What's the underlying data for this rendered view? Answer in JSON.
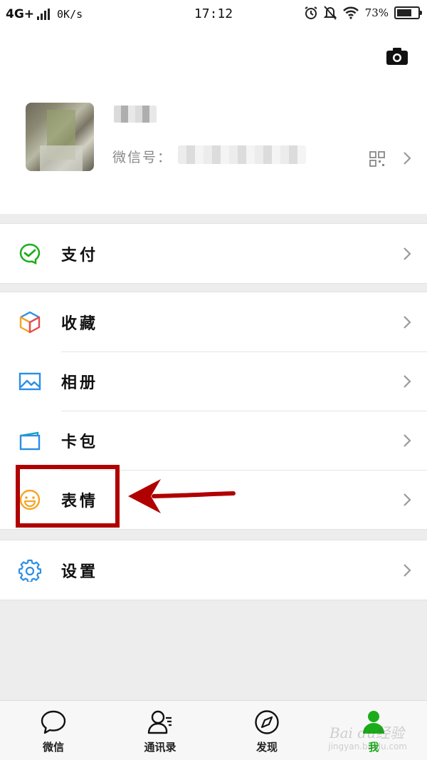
{
  "status_bar": {
    "network": "4G+",
    "speed": "0K/s",
    "time": "17:12",
    "battery_percent": "73%",
    "battery_level": 0.73
  },
  "profile": {
    "wechat_id_label": "微信号：",
    "icons": [
      "camera-icon",
      "qr-code-icon",
      "chevron-right-icon"
    ]
  },
  "menu": {
    "pay": {
      "label": "支付",
      "icon": "wechat-pay-icon"
    },
    "favorites": {
      "label": "收藏",
      "icon": "favorites-cube-icon"
    },
    "album": {
      "label": "相册",
      "icon": "album-icon"
    },
    "cards": {
      "label": "卡包",
      "icon": "card-wallet-icon"
    },
    "stickers": {
      "label": "表情",
      "icon": "smiley-icon"
    },
    "settings": {
      "label": "设置",
      "icon": "gear-icon"
    }
  },
  "tabs": [
    {
      "label": "微信",
      "icon": "chat-bubble-icon"
    },
    {
      "label": "通讯录",
      "icon": "contacts-icon"
    },
    {
      "label": "发现",
      "icon": "compass-icon"
    },
    {
      "label": "我",
      "icon": "me-person-icon",
      "active": true
    }
  ],
  "watermark": {
    "text": "Bai du经验",
    "sub": "jingyan.baidu.com"
  },
  "colors": {
    "accent_green": "#1aad19",
    "highlight_red": "#b00000",
    "background": "#ededed"
  }
}
